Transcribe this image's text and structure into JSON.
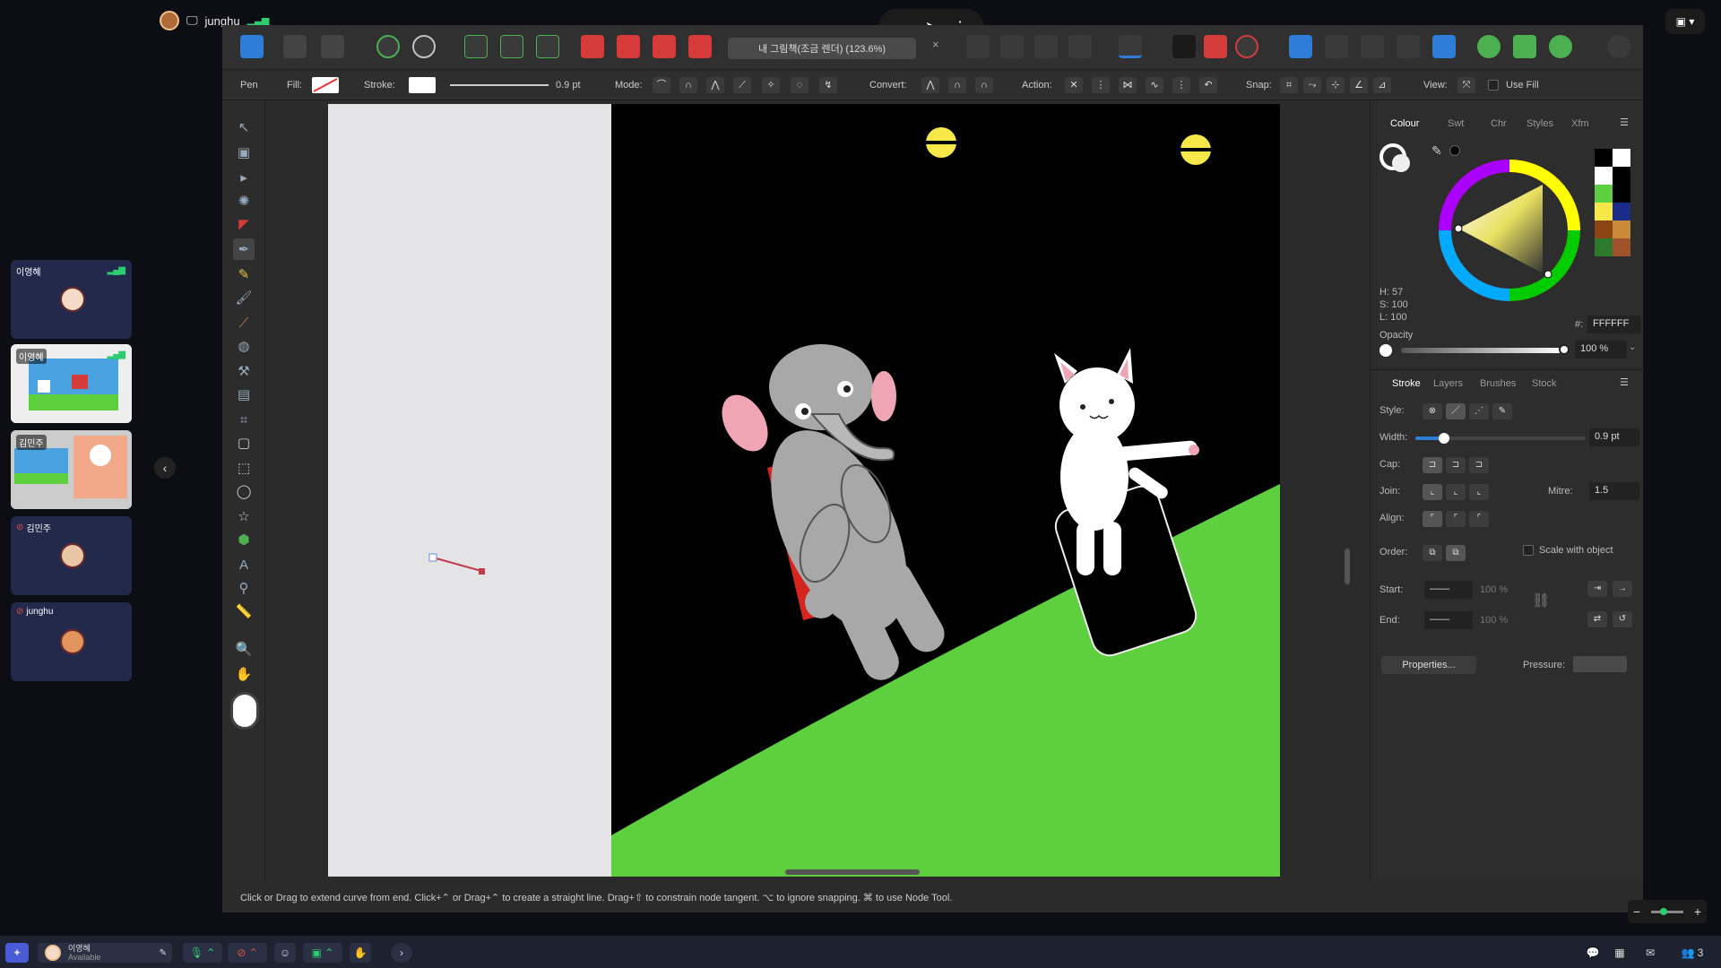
{
  "meeting": {
    "presenter_name": "junghu",
    "view_label": "▣ ▾"
  },
  "participants": [
    {
      "name": "이영혜",
      "type": "avatar"
    },
    {
      "name": "이영혜",
      "type": "screen"
    },
    {
      "name": "김민주",
      "type": "screen"
    },
    {
      "name": "김민주",
      "type": "avatar"
    },
    {
      "name": "junghu",
      "type": "avatar"
    }
  ],
  "toolbar": {
    "document_title": "내 그림책(조금 렌더) (123.6%)",
    "close_icon": "×"
  },
  "context": {
    "tool_name": "Pen",
    "fill_label": "Fill:",
    "stroke_label": "Stroke:",
    "stroke_width": "0.9 pt",
    "mode_label": "Mode:",
    "convert_label": "Convert:",
    "action_label": "Action:",
    "snap_label": "Snap:",
    "view_label": "View:",
    "use_fill_label": "Use Fill"
  },
  "colour_panel": {
    "tabs": [
      "Colour",
      "Swt",
      "Chr",
      "Styles",
      "Xfm"
    ],
    "h": "H: 57",
    "s": "S: 100",
    "l": "L: 100",
    "hex_label": "#:",
    "hex": "FFFFFF",
    "opacity_label": "Opacity",
    "opacity_value": "100 %"
  },
  "stroke_panel": {
    "tabs": [
      "Stroke",
      "Layers",
      "Brushes",
      "Stock"
    ],
    "style_label": "Style:",
    "width_label": "Width:",
    "width_value": "0.9 pt",
    "cap_label": "Cap:",
    "join_label": "Join:",
    "mitre_label": "Mitre:",
    "mitre_value": "1.5",
    "align_label": "Align:",
    "order_label": "Order:",
    "scale_label": "Scale with object",
    "start_label": "Start:",
    "end_label": "End:",
    "start_pct": "100 %",
    "end_pct": "100 %",
    "properties_button": "Properties...",
    "pressure_label": "Pressure:"
  },
  "status_bar": {
    "text": "Click or Drag to extend curve from end. Click+⌃ or Drag+⌃ to create a straight line. Drag+⇧ to constrain node tangent. ⌥ to ignore snapping. ⌘ to use Node Tool."
  },
  "taskbar": {
    "user_name": "이영혜",
    "user_status": "Available",
    "participant_count": "3"
  },
  "colors": {
    "accent": "#2e7dd7",
    "grass": "#5ecf3f",
    "canvas_bg": "#000000"
  }
}
